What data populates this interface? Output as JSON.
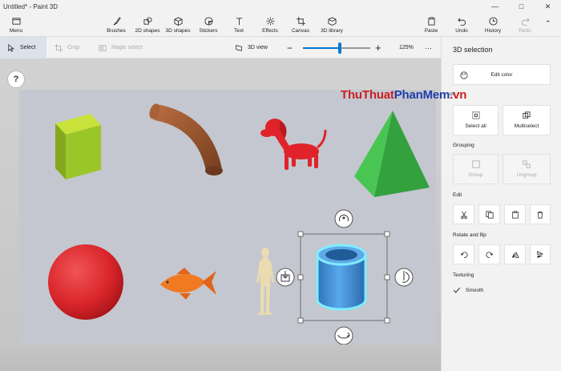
{
  "window": {
    "title": "Untitled* - Paint 3D"
  },
  "ribbon": {
    "menu": "Menu",
    "tools": [
      "Brushes",
      "2D shapes",
      "3D shapes",
      "Stickers",
      "Text",
      "Effects",
      "Canvas",
      "3D library"
    ],
    "right": [
      "Paste",
      "Undo",
      "History",
      "Redo"
    ]
  },
  "toolbar": {
    "select": "Select",
    "crop": "Crop",
    "magic_select": "Magic select",
    "view3d": "3D view",
    "zoom": "125%",
    "more": "···",
    "zoom_level": 0.55
  },
  "canvas": {
    "help": "?"
  },
  "panel": {
    "title": "3D selection",
    "edit_color": "Edit color",
    "partial": "ct",
    "select_all": "Select all",
    "multiselect": "Multiselect",
    "grouping": "Grouping",
    "group": "Group",
    "ungroup": "Ungroup",
    "edit": "Edit",
    "rotate_flip": "Rotate and flip",
    "texturing": "Texturing",
    "smooth": "Smooth"
  },
  "watermark": {
    "part1": "ThuThuat",
    "part2": "PhanMem",
    "part3": ".vn"
  },
  "colors": {
    "accent": "#0078d7",
    "cube": "#9bc62a",
    "pyramid": "#3cb64a",
    "dog": "#e0232a",
    "ball": "#d9252a",
    "fish": "#f07a22",
    "cylinder": "#3b8fd6",
    "tube": "#9a5a33"
  }
}
